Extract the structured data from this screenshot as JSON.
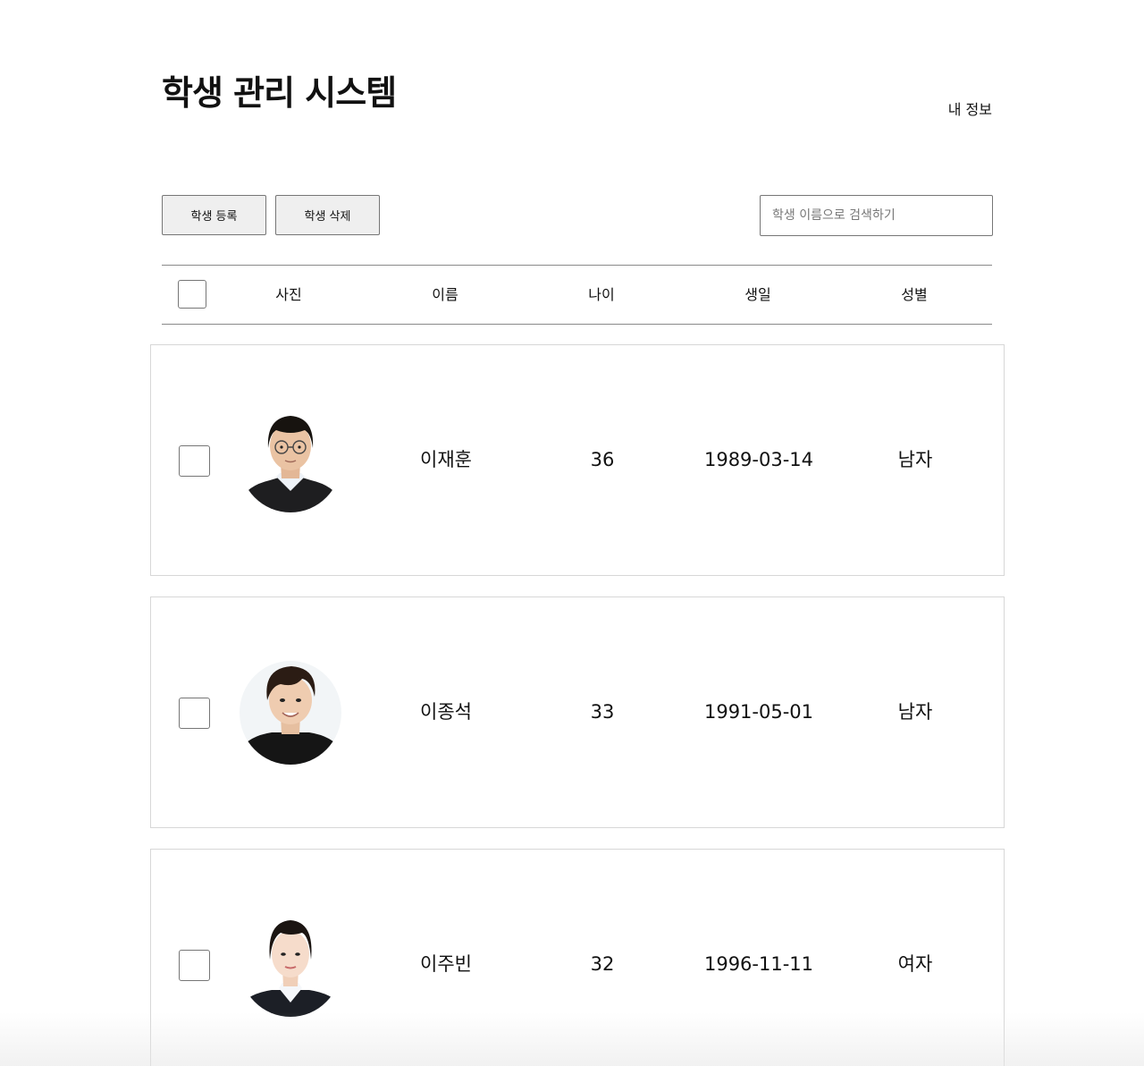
{
  "header": {
    "title": "학생 관리 시스템",
    "my_info": "내 정보"
  },
  "toolbar": {
    "register_label": "학생 등록",
    "delete_label": "학생 삭제",
    "search_placeholder": "학생 이름으로 검색하기",
    "search_value": ""
  },
  "table": {
    "columns": [
      "사진",
      "이름",
      "나이",
      "생일",
      "성별"
    ],
    "rows": [
      {
        "photo": "student-photo-male-glasses",
        "name": "이재훈",
        "age": "36",
        "birthday": "1989-03-14",
        "gender": "남자"
      },
      {
        "photo": "student-photo-male",
        "name": "이종석",
        "age": "33",
        "birthday": "1991-05-01",
        "gender": "남자"
      },
      {
        "photo": "student-photo-female",
        "name": "이주빈",
        "age": "32",
        "birthday": "1996-11-11",
        "gender": "여자"
      }
    ]
  }
}
